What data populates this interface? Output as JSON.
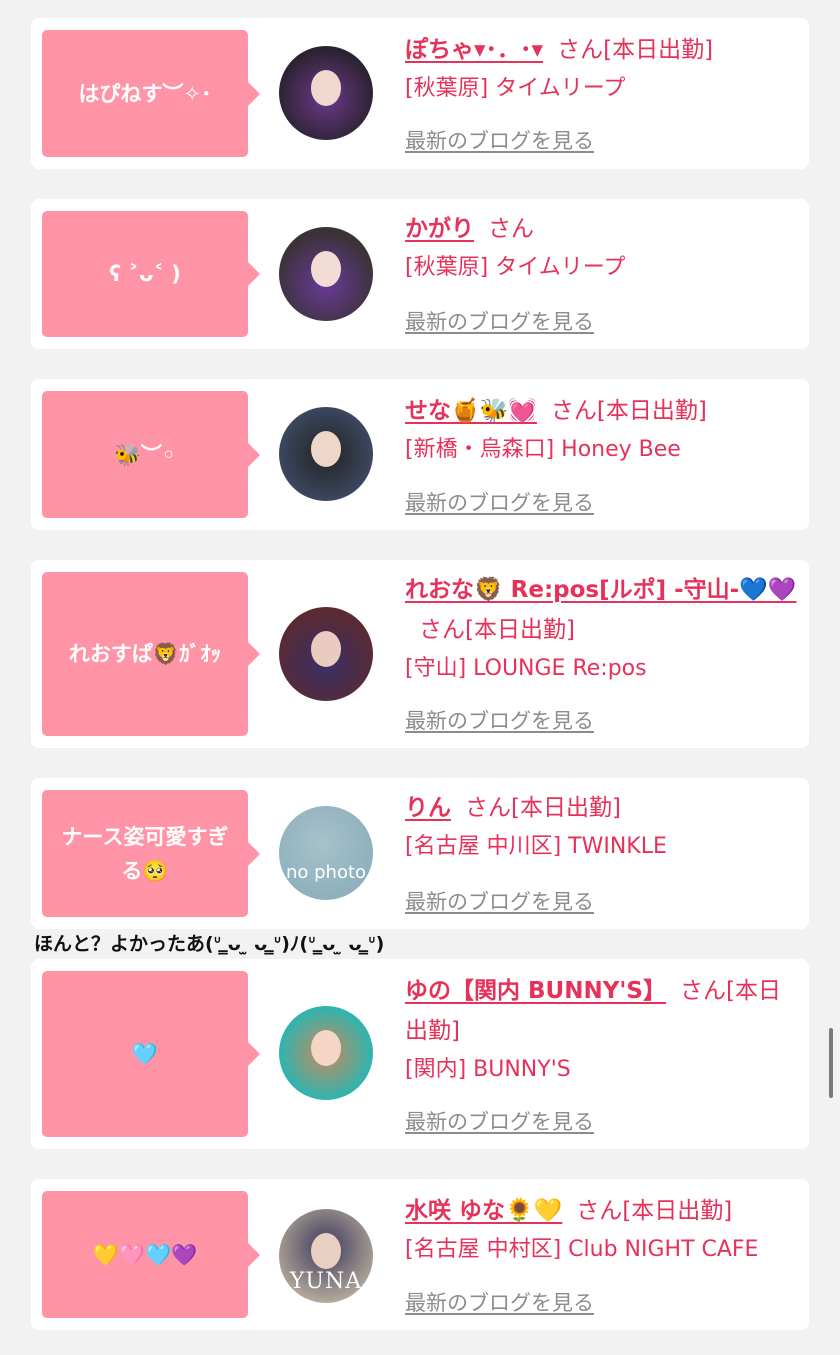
{
  "cards": [
    {
      "comment": "はぴねす︶✧･",
      "name": "ぽちゃ▾･．･▾",
      "san": "さん",
      "status": "[本日出勤]",
      "shop": "[秋葉原] タイムリープ",
      "blog": "最新のブログを見る",
      "avatar": {
        "bg": "#2b2230",
        "skin": "#f1d8cf",
        "accent": "#6d3a8c"
      }
    },
    {
      "comment": "ʕ ˃ᴗ˂ )",
      "name": "かがり",
      "san": "さん",
      "status": "",
      "shop": "[秋葉原] タイムリープ",
      "blog": "最新のブログを見る",
      "avatar": {
        "bg": "#3a3236",
        "skin": "#f2dcd5",
        "accent": "#6a3a9a"
      }
    },
    {
      "comment": "🐝︶◦",
      "name": "せな🍯🐝💓",
      "san": "さん",
      "status": "[本日出勤]",
      "shop": "[新橋・烏森口] Honey Bee",
      "blog": "最新のブログを見る",
      "avatar": {
        "bg": "#3d4a63",
        "skin": "#eed6c8",
        "accent": "#222222"
      }
    },
    {
      "comment": "れおすぱ🦁ｶﾞｵｯ",
      "name": "れおな🦁 Re:pos[ルポ] -守山-💙💜",
      "san": "さん",
      "status": "[本日出勤]",
      "shop": "[守山] LOUNGE Re:pos",
      "blog": "最新のブログを見る",
      "avatar": {
        "bg": "#5c2a30",
        "skin": "#eacbc0",
        "accent": "#3a2f66"
      }
    },
    {
      "comment": "ナース姿可愛すぎる🥺",
      "name": "りん",
      "san": "さん",
      "status": "[本日出勤]",
      "shop": "[名古屋 中川区] TWINKLE",
      "blog": "最新のブログを見る",
      "avatar": {
        "bg": "#8fb0bc",
        "skin": "#a6c2cc",
        "accent": "#7d9da8",
        "label": "no photo"
      }
    },
    {
      "comment": "🩵",
      "name": "ゆの【関内 BUNNY'S】",
      "san": "さん",
      "status": "[本日出勤]",
      "shop": "[関内] BUNNY'S",
      "blog": "最新のブログを見る",
      "avatar": {
        "bg": "#2fb4b0",
        "skin": "#f3d6c6",
        "accent": "#c88a5a"
      }
    },
    {
      "comment": "💛🩷🩵💜",
      "name": "水咲 ゆな🌻💛",
      "san": "さん",
      "status": "[本日出勤]",
      "shop": "[名古屋 中村区] Club NIGHT CAFE",
      "blog": "最新のブログを見る",
      "avatar": {
        "bg": "#b4a89a",
        "skin": "#e8cfc2",
        "accent": "#3b3a5c",
        "label": "YUNA"
      }
    }
  ],
  "reply": "ほんと？よかったあ(ᐡ ̳ᴗ  ̫ ᴗ ̳ᐡ)ﾉ(ᐡ ̳ᴗ  ̫ ᴗ ̳ᐡ)"
}
